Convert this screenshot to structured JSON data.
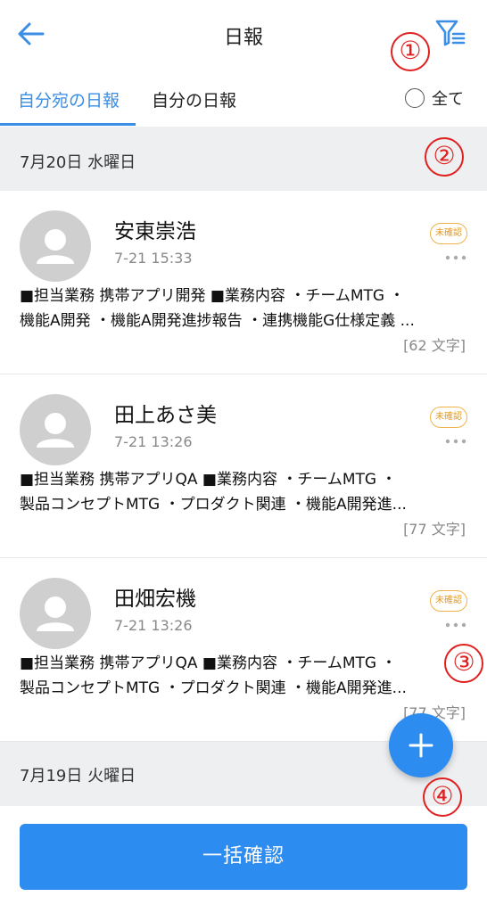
{
  "header": {
    "title": "日報",
    "back_icon": "arrow-left-icon",
    "filter_icon": "filter-icon",
    "accent_color": "#3a8ee6"
  },
  "tabs": [
    {
      "label": "自分宛の日報",
      "active": true
    },
    {
      "label": "自分の日報",
      "active": false
    }
  ],
  "all_toggle": {
    "label": "全て",
    "checked": false
  },
  "sections": [
    {
      "date": "7月20日 水曜日",
      "reports": [
        {
          "name": "安東崇浩",
          "time": "7-21 15:33",
          "badge": "未確認",
          "line1": "■担当業務 携帯アプリ開発 ■業務内容 ・チームMTG ・",
          "line2": "機能A開発 ・機能A開発進捗報告 ・連携機能G仕様定義 ...",
          "count": "[62 文字]"
        },
        {
          "name": "田上あさ美",
          "time": "7-21 13:26",
          "badge": "未確認",
          "line1": "■担当業務 携帯アプリQA ■業務内容 ・チームMTG ・",
          "line2": "製品コンセプトMTG ・プロダクト関連 ・機能A開発進...",
          "count": "[77 文字]"
        },
        {
          "name": "田畑宏機",
          "time": "7-21 13:26",
          "badge": "未確認",
          "line1": "■担当業務 携帯アプリQA ■業務内容 ・チームMTG ・",
          "line2": "製品コンセプトMTG ・プロダクト関連 ・機能A開発進...",
          "count": "[77 文字]"
        }
      ]
    },
    {
      "date": "7月19日 火曜日",
      "reports": []
    }
  ],
  "fab": {
    "icon": "plus-icon",
    "color": "#2d8cf0"
  },
  "bottom_button": {
    "label": "一括確認",
    "color": "#2d8cf0"
  },
  "callouts": [
    "①",
    "②",
    "③",
    "④"
  ],
  "callout_color": "#e02020",
  "badge_color": "#f0b24a"
}
